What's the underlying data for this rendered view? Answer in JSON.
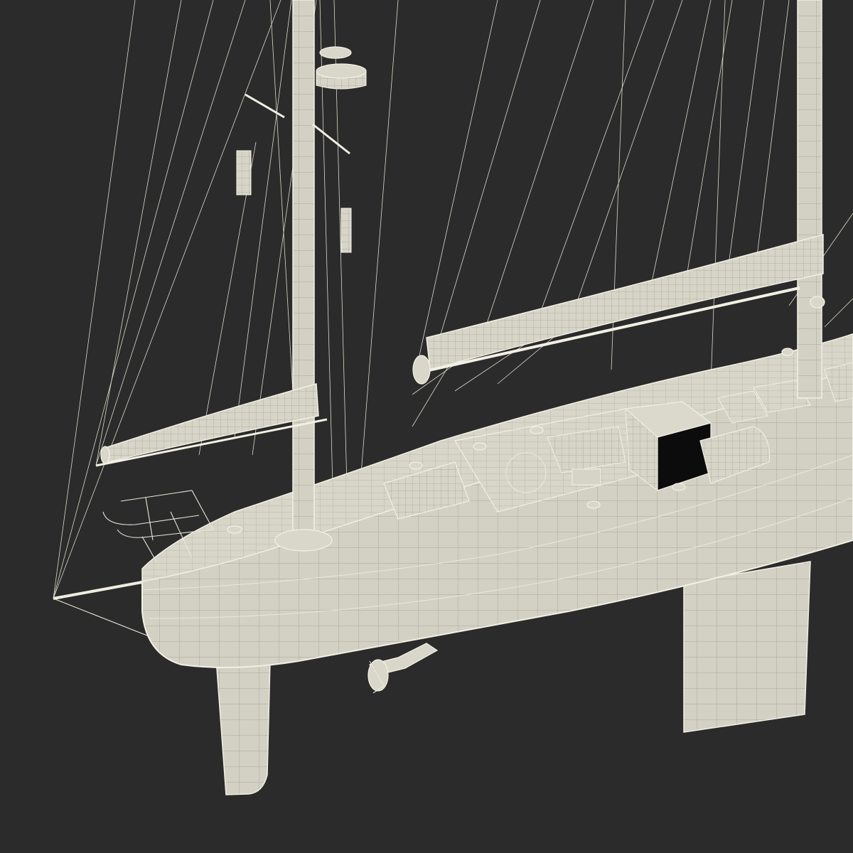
{
  "scene": {
    "background": "#2b2b2b",
    "wireframe_color": "#e9e7da",
    "surface_color": "#d9d7c9"
  }
}
